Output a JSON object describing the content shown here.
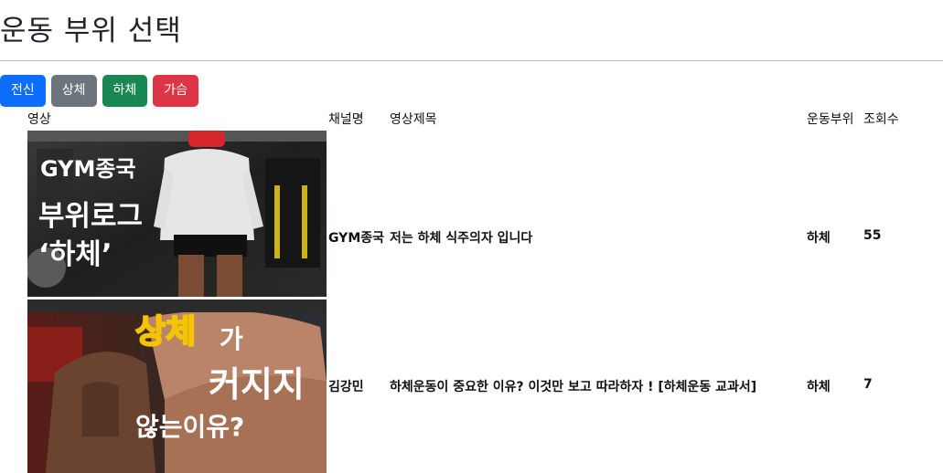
{
  "page": {
    "title": "운동 부위 선택"
  },
  "filters": {
    "buttons": [
      {
        "label": "전신",
        "color": "#0d6efd"
      },
      {
        "label": "상체",
        "color": "#6c757d"
      },
      {
        "label": "하체",
        "color": "#198754"
      },
      {
        "label": "가슴",
        "color": "#dc3545"
      }
    ]
  },
  "table": {
    "headers": {
      "video": "영상",
      "channel": "채널명",
      "title": "영상제목",
      "body_part": "운동부위",
      "views": "조회수"
    },
    "rows": [
      {
        "thumbnail": {
          "icon": "video-thumbnail-image",
          "line1": "GYM종국",
          "line2": "부위로그",
          "line3": "‘하체’"
        },
        "channel": "GYM종국",
        "title": "저는 하체 식주의자 입니다",
        "body_part": "하체",
        "views": "55"
      },
      {
        "thumbnail": {
          "icon": "video-thumbnail-image",
          "line1": "상체",
          "line2": "가",
          "line3": "커지지",
          "line4": "않는이유?"
        },
        "channel": "김강민",
        "title": "하체운동이 중요한 이유? 이것만 보고 따라하자 ! [하체운동 교과서]",
        "body_part": "하체",
        "views": "7"
      }
    ]
  }
}
